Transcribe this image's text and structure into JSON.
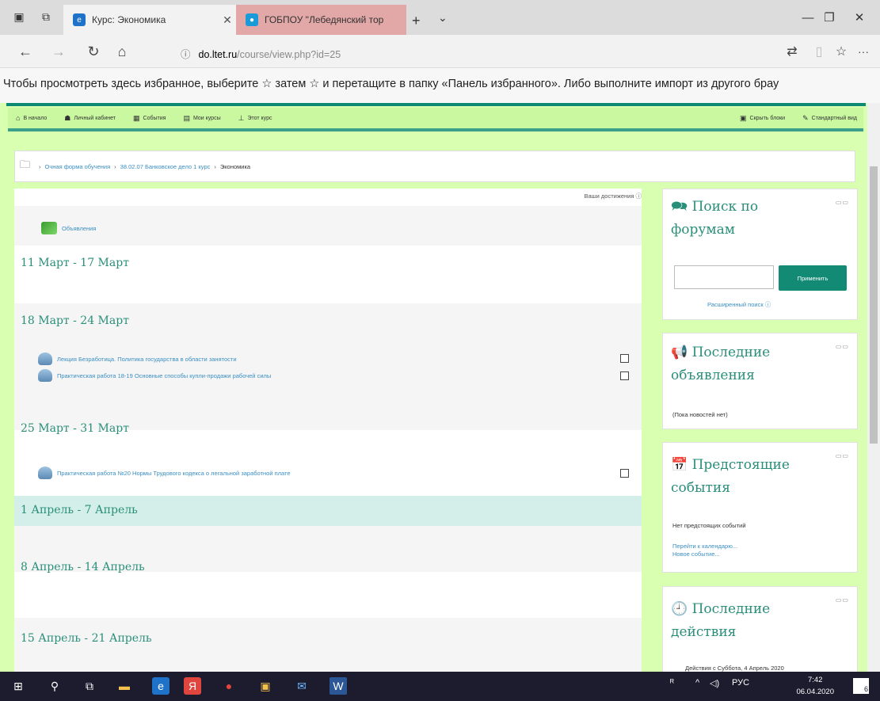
{
  "browser": {
    "tabs": [
      {
        "label": "Курс: Экономика",
        "fav_color": "#1e73c9",
        "active": true
      },
      {
        "label": "ГОБПОУ \"Лебедянский тор",
        "fav_color": "#1a9ad6",
        "active": false
      }
    ],
    "url_host": "do.ltet.ru",
    "url_path": "/course/view.php?id=25",
    "favorites_hint": "Чтобы просмотреть здесь избранное, выберите ☆ затем ☆ и перетащите в папку «Панель избранного». Либо выполните импорт из другого брау"
  },
  "moodle_nav": {
    "items": [
      {
        "icon": "home-icon",
        "label": "В начало"
      },
      {
        "icon": "dashboard-icon",
        "label": "Личный кабинет"
      },
      {
        "icon": "calendar-icon",
        "label": "События"
      },
      {
        "icon": "courses-icon",
        "label": "Мои курсы"
      },
      {
        "icon": "course-icon",
        "label": "Этот курс"
      }
    ],
    "right_items": [
      {
        "icon": "blocks-icon",
        "label": "Скрыть блоки"
      },
      {
        "icon": "pencil-icon",
        "label": "Стандартный вид"
      }
    ]
  },
  "breadcrumb": {
    "items": [
      "Очная форма обучения",
      "38.02.07 Банковское дело 1 курс"
    ],
    "current": "Экономика"
  },
  "course": {
    "achievements": "Ваши достижения ⓘ",
    "announcements": "Объявления",
    "sections": [
      {
        "title": "11 Март - 17 Март",
        "activities": []
      },
      {
        "title": "18 Март - 24 Март",
        "activities": [
          "Лекция Безработица. Политика государства в области занятости",
          "Практическая работа 18-19 Основные способы купли-продажи рабочей силы"
        ]
      },
      {
        "title": "25 Март - 31 Март",
        "activities": [
          "Практическая работа №20 Нормы Трудового кодекса о легальной заработной плате"
        ]
      },
      {
        "title": "1 Апрель - 7 Апрель",
        "activities": [],
        "highlighted": true
      },
      {
        "title": "8 Апрель - 14 Апрель",
        "activities": []
      },
      {
        "title": "15 Апрель - 21 Апрель",
        "activities": []
      }
    ]
  },
  "blocks": {
    "forum_search": {
      "title": "Поиск по форумам",
      "button": "Применить",
      "advanced": "Расширенный поиск ⓘ"
    },
    "news": {
      "title": "Последние объявления",
      "empty": "(Пока новостей нет)"
    },
    "upcoming": {
      "title": "Предстоящие события",
      "empty": "Нет предстоящих событий",
      "link_calendar": "Перейти к календарю...",
      "link_new": "Новое событие..."
    },
    "recent": {
      "title": "Последние действия",
      "text": "Действия с Суббота, 4 Апрель 2020"
    }
  },
  "taskbar": {
    "lang": "РУС",
    "time": "7:42",
    "date": "06.04.2020",
    "notifications": "6"
  },
  "colors": {
    "accent": "#2a8f7a",
    "page_bg": "#d9ffb0",
    "button": "#138a73",
    "link": "#3b8fc4"
  }
}
